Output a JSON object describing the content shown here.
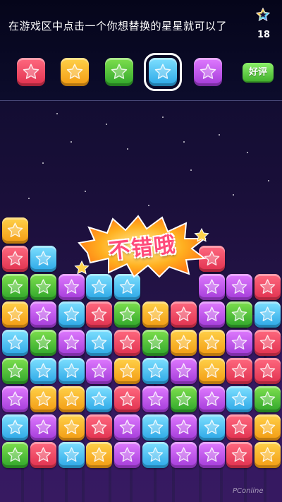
{
  "header": {
    "instruction": "在游戏区中点击一个你想替换的星星就可以了",
    "counter": "18",
    "rate_label": "好评"
  },
  "palette": [
    {
      "color": "red",
      "selected": false
    },
    {
      "color": "yellow",
      "selected": false
    },
    {
      "color": "green",
      "selected": false
    },
    {
      "color": "blue",
      "selected": true
    },
    {
      "color": "purple",
      "selected": false
    }
  ],
  "banner": {
    "text": "不错哦"
  },
  "board": {
    "rows": [
      [
        "yellow",
        null,
        null,
        null,
        null,
        null,
        null,
        null,
        null,
        null
      ],
      [
        "red",
        "blue",
        null,
        null,
        null,
        null,
        null,
        "red",
        null,
        null
      ],
      [
        "green",
        "green",
        "purple",
        "blue",
        "blue",
        null,
        null,
        "purple",
        "purple",
        "red"
      ],
      [
        "yellow",
        "purple",
        "blue",
        "red",
        "green",
        "yellow",
        "red",
        "purple",
        "green",
        "blue"
      ],
      [
        "blue",
        "green",
        "purple",
        "blue",
        "red",
        "green",
        "yellow",
        "yellow",
        "purple",
        "red"
      ],
      [
        "green",
        "blue",
        "blue",
        "purple",
        "yellow",
        "blue",
        "purple",
        "yellow",
        "red",
        "red"
      ],
      [
        "purple",
        "yellow",
        "yellow",
        "blue",
        "red",
        "purple",
        "green",
        "purple",
        "blue",
        "green"
      ],
      [
        "blue",
        "purple",
        "yellow",
        "red",
        "purple",
        "blue",
        "purple",
        "blue",
        "red",
        "yellow"
      ],
      [
        "green",
        "red",
        "blue",
        "yellow",
        "purple",
        "blue",
        "purple",
        "purple",
        "red",
        "yellow"
      ]
    ]
  },
  "colors": {
    "red": "#e8405c",
    "yellow": "#f5b020",
    "green": "#3fbf35",
    "blue": "#3ab8f0",
    "purple": "#b94ae6"
  },
  "watermark": "PConline"
}
